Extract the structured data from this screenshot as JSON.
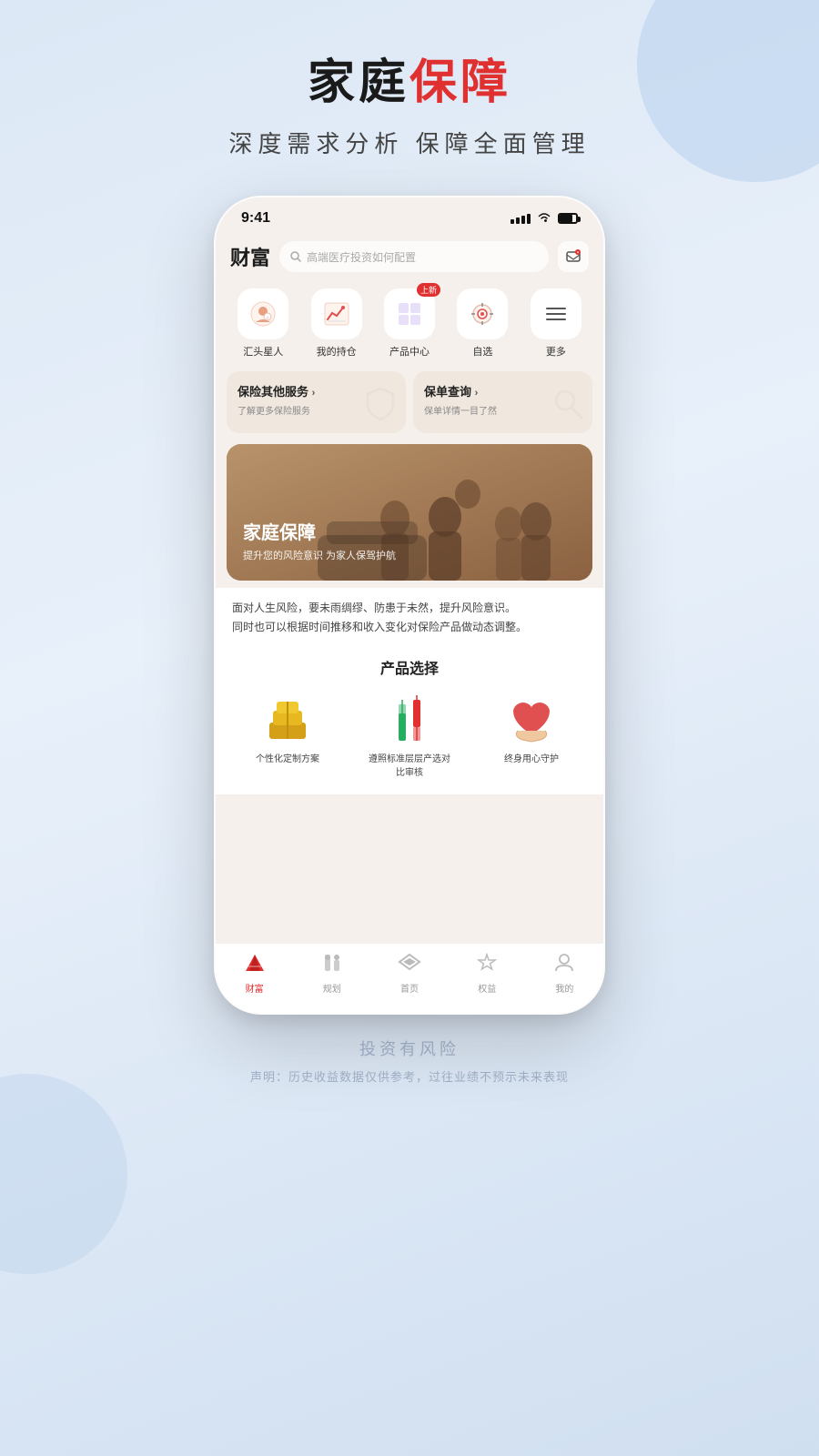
{
  "page": {
    "background": "#dce8f5"
  },
  "header": {
    "title_black": "家庭",
    "title_red": "保障",
    "subtitle": "深度需求分析  保障全面管理"
  },
  "phone": {
    "status_bar": {
      "time": "9:41",
      "signal": "▌▌▌",
      "wifi": "WiFi",
      "battery": "Battery"
    },
    "app_header": {
      "title": "财富",
      "search_placeholder": "高端医疗投资如何配置",
      "icon": "📋"
    },
    "quick_icons": [
      {
        "id": "huihead",
        "icon": "😊",
        "label": "汇头星人",
        "badge": ""
      },
      {
        "id": "holdings",
        "icon": "📈",
        "label": "我的持仓",
        "badge": ""
      },
      {
        "id": "products",
        "icon": "⊞",
        "label": "产品中心",
        "badge": "上新"
      },
      {
        "id": "watchlist",
        "icon": "◎",
        "label": "自选",
        "badge": ""
      },
      {
        "id": "more",
        "icon": "☰",
        "label": "更多",
        "badge": ""
      }
    ],
    "service_cards": [
      {
        "title": "保险其他服务",
        "subtitle": "了解更多保险服务",
        "arrow": "›",
        "icon": "🛡"
      },
      {
        "title": "保单查询",
        "subtitle": "保单详情一目了然",
        "arrow": "›",
        "icon": "🔍"
      }
    ],
    "family_banner": {
      "title": "家庭保障",
      "subtitle": "提升您的风险意识 为家人保驾护航"
    },
    "desc": {
      "text1": "面对人生风险，要未雨绸缪、防患于未然，提升风险意识。",
      "text2": "同时也可以根据时间推移和收入变化对保险产品做动态调整。"
    },
    "product_section": {
      "title": "产品选择",
      "items": [
        {
          "icon": "🧱",
          "label": "个性化定制方案"
        },
        {
          "icon": "📊",
          "label": "遵照标准层层产选对比审核"
        },
        {
          "icon": "❤️",
          "label": "终身用心守护"
        }
      ]
    },
    "bottom_nav": [
      {
        "id": "wealth",
        "icon": "◀",
        "label": "财富",
        "active": true
      },
      {
        "id": "plan",
        "icon": "🏠",
        "label": "规划",
        "active": false
      },
      {
        "id": "home",
        "icon": "◆",
        "label": "首页",
        "active": false
      },
      {
        "id": "benefits",
        "icon": "✓",
        "label": "权益",
        "active": false
      },
      {
        "id": "mine",
        "icon": "👤",
        "label": "我的",
        "active": false
      }
    ]
  },
  "footer": {
    "risk_text": "投资有风险",
    "disclaimer": "声明：历史收益数据仅供参考，过往业绩不预示未来表现"
  }
}
